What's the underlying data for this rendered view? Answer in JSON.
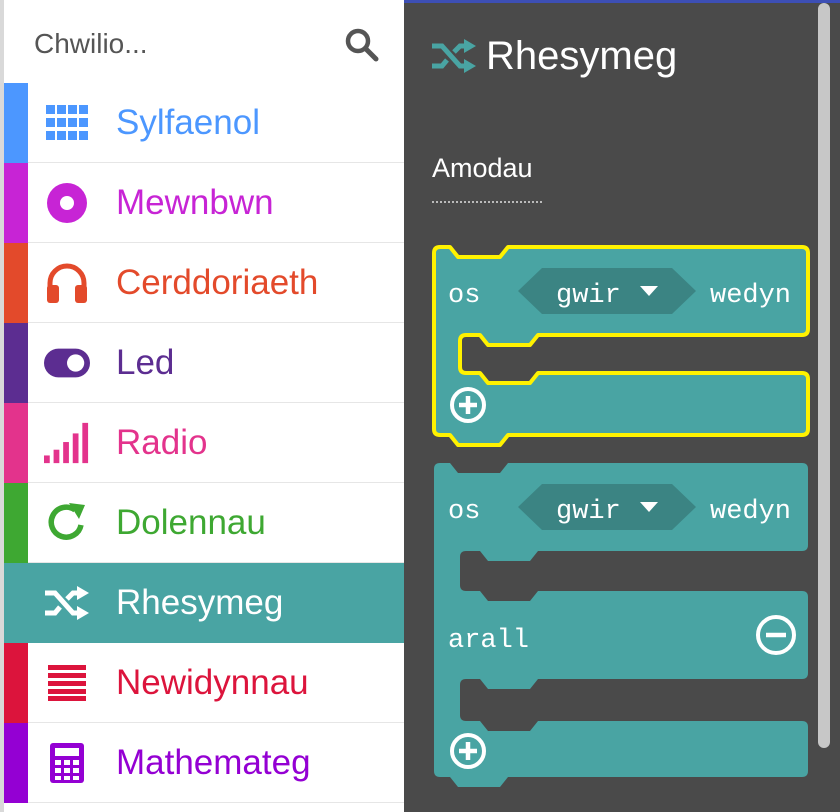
{
  "search": {
    "placeholder": "Chwilio..."
  },
  "categories": [
    {
      "label": "Sylfaenol",
      "icon": "grid-icon",
      "color": "#4c97ff"
    },
    {
      "label": "Mewnbwn",
      "icon": "input-circle-icon",
      "color": "#c724d5"
    },
    {
      "label": "Cerddoriaeth",
      "icon": "headphones-icon",
      "color": "#e34a2b"
    },
    {
      "label": "Led",
      "icon": "toggle-icon",
      "color": "#5c2d91"
    },
    {
      "label": "Radio",
      "icon": "signal-bars-icon",
      "color": "#e3338c"
    },
    {
      "label": "Dolennau",
      "icon": "refresh-icon",
      "color": "#3ea832"
    },
    {
      "label": "Rhesymeg",
      "icon": "shuffle-icon",
      "color": "#49a4a3",
      "selected": true
    },
    {
      "label": "Newidynnau",
      "icon": "list-lines-icon",
      "color": "#dc143c"
    },
    {
      "label": "Mathemateg",
      "icon": "calculator-icon",
      "color": "#9400d3"
    }
  ],
  "flyout": {
    "title": "Rhesymeg",
    "section": "Amodau",
    "block1": {
      "if_label": "os",
      "dropdown": "gwir",
      "then_label": "wedyn"
    },
    "block2": {
      "if_label": "os",
      "dropdown": "gwir",
      "then_label": "wedyn",
      "else_label": "arall"
    }
  },
  "colors": {
    "block": "#49a4a3",
    "block_dark": "#3b8483",
    "highlight": "#fff200",
    "flyout_bg": "#4a4a4a"
  }
}
